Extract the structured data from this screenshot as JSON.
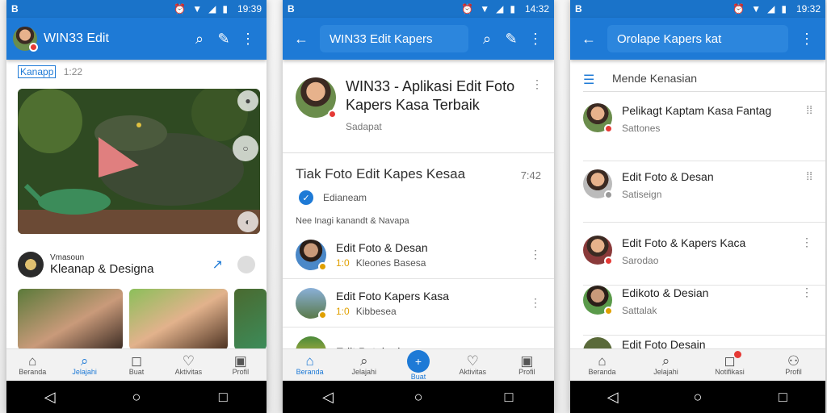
{
  "status": {
    "left_icon": "B",
    "time_p1": "19:39",
    "time_p2": "14:32",
    "time_p3": "19:32"
  },
  "phone1": {
    "app_title": "WIN33 Edit",
    "tag_label": "Kanapp",
    "tag_number": "1:22",
    "post_small": "Vmasoun",
    "post_title": "Kleanap & Designa",
    "nav": [
      {
        "label": "Beranda",
        "icon": "⌂"
      },
      {
        "label": "Jelajahi",
        "icon": "⌕"
      },
      {
        "label": "Buat",
        "icon": "◻"
      },
      {
        "label": "Aktivitas",
        "icon": "♡"
      },
      {
        "label": "Profil",
        "icon": "▣"
      }
    ]
  },
  "phone2": {
    "search_text": "WIN33 Edit Kapers",
    "head_title": "WIN33 - Aplikasi Edit Foto Kapers Kasa Terbaik",
    "head_sub": "Sadapat",
    "section_title": "Tiak Foto Edit Kapes Kesaa",
    "section_time": "7:42",
    "chip_label": "Edianeam",
    "sub_label": "Nee Inagi kanandt & Navapa",
    "rows": [
      {
        "title": "Edit Foto & Desan",
        "tag": "1:0",
        "meta": "Kleones Basesa"
      },
      {
        "title": "Edit Foto Kapers Kasa",
        "tag": "1:0",
        "meta": "Kibbesea"
      },
      {
        "title": "Edit Potekark",
        "tag": "",
        "meta": ""
      }
    ],
    "nav": [
      {
        "label": "Beranda",
        "icon": "⌂"
      },
      {
        "label": "Jelajahi",
        "icon": "⌕"
      },
      {
        "label": "Buat",
        "icon": "+"
      },
      {
        "label": "Aktivitas",
        "icon": "♡"
      },
      {
        "label": "Profil",
        "icon": "▣"
      }
    ]
  },
  "phone3": {
    "search_text": "Orolape Kapers kat",
    "head_label": "Mende Kenasian",
    "rows": [
      {
        "title": "Pelikagt Kaptam Kasa Fantag",
        "meta": "Sattones"
      },
      {
        "title": "Edit Foto & Desan",
        "meta": "Satiseign"
      },
      {
        "title": "Edit Foto & Kapers Kaca",
        "meta": "Sarodao"
      },
      {
        "title": "Edikoto & Desian",
        "meta": "Sattalak"
      },
      {
        "title": "Edit Foto Desain",
        "meta": ""
      }
    ],
    "nav": [
      {
        "label": "Beranda",
        "icon": "⌂"
      },
      {
        "label": "Jelajahi",
        "icon": "⌕"
      },
      {
        "label": "Notifikasi",
        "icon": "◻"
      },
      {
        "label": "Profil",
        "icon": "⚇"
      }
    ]
  },
  "colors": {
    "accent": "#1e7ad6",
    "status_bar": "#1a73c9",
    "badge": "#e53935"
  }
}
